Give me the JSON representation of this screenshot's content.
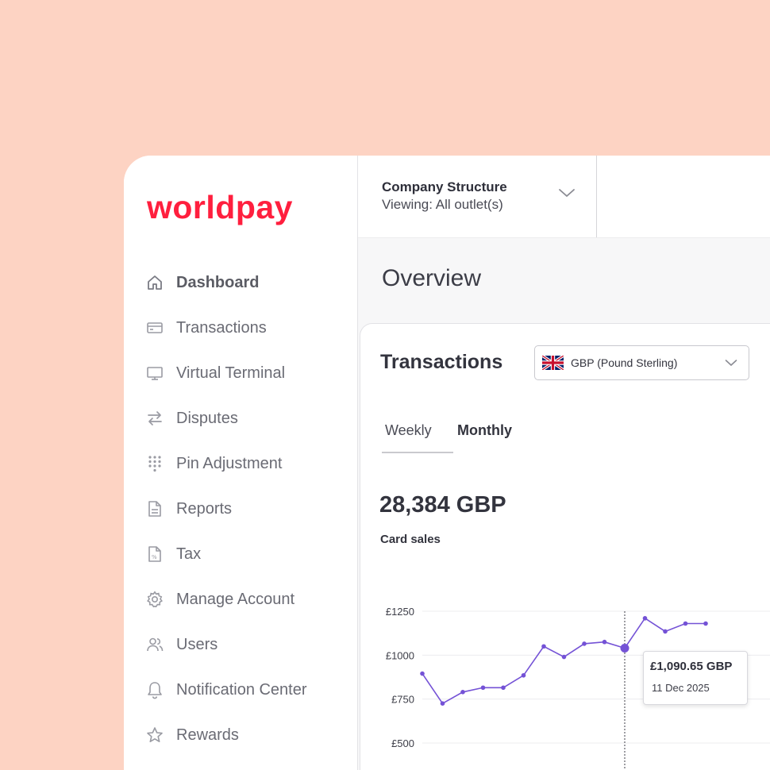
{
  "brand": {
    "name": "worldpay",
    "color": "#ff1f3e"
  },
  "sidebar": {
    "items": [
      {
        "label": "Dashboard",
        "icon": "home-icon",
        "active": true
      },
      {
        "label": "Transactions",
        "icon": "card-icon"
      },
      {
        "label": "Virtual Terminal",
        "icon": "monitor-icon"
      },
      {
        "label": "Disputes",
        "icon": "arrows-swap-icon"
      },
      {
        "label": "Pin Adjustment",
        "icon": "keypad-icon"
      },
      {
        "label": "Reports",
        "icon": "document-icon"
      },
      {
        "label": "Tax",
        "icon": "tax-document-icon"
      },
      {
        "label": "Manage Account",
        "icon": "gear-icon"
      },
      {
        "label": "Users",
        "icon": "users-icon"
      },
      {
        "label": "Notification Center",
        "icon": "bell-icon"
      },
      {
        "label": "Rewards",
        "icon": "star-icon"
      }
    ]
  },
  "topbar": {
    "company_title": "Company Structure",
    "company_viewing": "Viewing: All outlet(s)"
  },
  "page": {
    "title": "Overview"
  },
  "transactions": {
    "title": "Transactions",
    "currency": "GBP (Pound Sterling)",
    "tabs": [
      {
        "label": "Weekly"
      },
      {
        "label": "Monthly"
      }
    ],
    "amount": "28,384 GBP",
    "amount_label": "Card sales",
    "tooltip": {
      "value": "£1,090.65 GBP",
      "date": "11 Dec 2025"
    }
  },
  "chart_data": {
    "type": "line",
    "color": "#7452d6",
    "y_ticks": [
      "£1250",
      "£1000",
      "£750",
      "£500"
    ],
    "y_tick_values": [
      1250,
      1000,
      750,
      500
    ],
    "ylim": [
      430,
      1300
    ],
    "values": [
      895,
      725,
      790,
      815,
      815,
      885,
      1050,
      990,
      1065,
      1075,
      1040,
      1210,
      1135,
      1180,
      1180
    ],
    "highlight_index": 10
  }
}
